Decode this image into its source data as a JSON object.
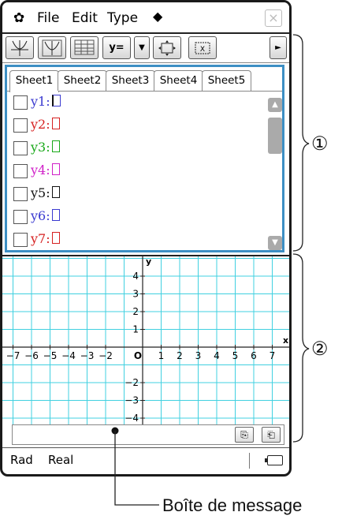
{
  "menubar": {
    "items": [
      "File",
      "Edit",
      "Type"
    ],
    "gear_icon": "gear-icon",
    "close_label": "×"
  },
  "toolbar": {
    "y_equals": "y=",
    "dropdown": "▼",
    "right_arrow": "►"
  },
  "tabs": [
    "Sheet1",
    "Sheet2",
    "Sheet3",
    "Sheet4",
    "Sheet5"
  ],
  "functions": [
    {
      "label": "y1:",
      "color": "#3a3ad0"
    },
    {
      "label": "y2:",
      "color": "#d62020"
    },
    {
      "label": "y3:",
      "color": "#18a818"
    },
    {
      "label": "y4:",
      "color": "#d020c8"
    },
    {
      "label": "y5:",
      "color": "#111111"
    },
    {
      "label": "y6:",
      "color": "#3a3ad0"
    },
    {
      "label": "y7:",
      "color": "#d62020"
    }
  ],
  "graph": {
    "grid_color": "#40d0e0",
    "x_ticks": [
      "−7",
      "−6",
      "−5",
      "−4",
      "−3",
      "−2",
      "O",
      "1",
      "2",
      "3",
      "4",
      "5",
      "6",
      "7"
    ],
    "y_ticks": [
      "4",
      "3",
      "2",
      "1",
      "−2",
      "−3",
      "−4"
    ],
    "x_axis_label": "x",
    "y_axis_label": "y"
  },
  "status": {
    "angle": "Rad",
    "mode": "Real"
  },
  "annotations": {
    "region1": "①",
    "region2": "②",
    "message_box_label": "Boîte de message"
  }
}
